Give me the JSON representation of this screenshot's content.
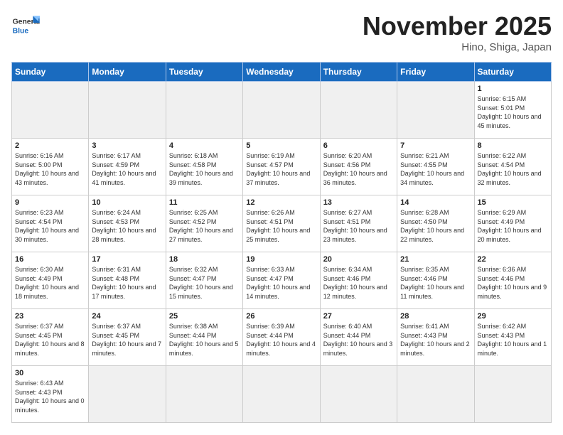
{
  "logo": {
    "line1": "General",
    "line2": "Blue"
  },
  "title": "November 2025",
  "subtitle": "Hino, Shiga, Japan",
  "weekdays": [
    "Sunday",
    "Monday",
    "Tuesday",
    "Wednesday",
    "Thursday",
    "Friday",
    "Saturday"
  ],
  "days": [
    {
      "date": "",
      "info": ""
    },
    {
      "date": "",
      "info": ""
    },
    {
      "date": "",
      "info": ""
    },
    {
      "date": "",
      "info": ""
    },
    {
      "date": "",
      "info": ""
    },
    {
      "date": "",
      "info": ""
    },
    {
      "date": "1",
      "info": "Sunrise: 6:15 AM\nSunset: 5:01 PM\nDaylight: 10 hours and 45 minutes."
    },
    {
      "date": "2",
      "info": "Sunrise: 6:16 AM\nSunset: 5:00 PM\nDaylight: 10 hours and 43 minutes."
    },
    {
      "date": "3",
      "info": "Sunrise: 6:17 AM\nSunset: 4:59 PM\nDaylight: 10 hours and 41 minutes."
    },
    {
      "date": "4",
      "info": "Sunrise: 6:18 AM\nSunset: 4:58 PM\nDaylight: 10 hours and 39 minutes."
    },
    {
      "date": "5",
      "info": "Sunrise: 6:19 AM\nSunset: 4:57 PM\nDaylight: 10 hours and 37 minutes."
    },
    {
      "date": "6",
      "info": "Sunrise: 6:20 AM\nSunset: 4:56 PM\nDaylight: 10 hours and 36 minutes."
    },
    {
      "date": "7",
      "info": "Sunrise: 6:21 AM\nSunset: 4:55 PM\nDaylight: 10 hours and 34 minutes."
    },
    {
      "date": "8",
      "info": "Sunrise: 6:22 AM\nSunset: 4:54 PM\nDaylight: 10 hours and 32 minutes."
    },
    {
      "date": "9",
      "info": "Sunrise: 6:23 AM\nSunset: 4:54 PM\nDaylight: 10 hours and 30 minutes."
    },
    {
      "date": "10",
      "info": "Sunrise: 6:24 AM\nSunset: 4:53 PM\nDaylight: 10 hours and 28 minutes."
    },
    {
      "date": "11",
      "info": "Sunrise: 6:25 AM\nSunset: 4:52 PM\nDaylight: 10 hours and 27 minutes."
    },
    {
      "date": "12",
      "info": "Sunrise: 6:26 AM\nSunset: 4:51 PM\nDaylight: 10 hours and 25 minutes."
    },
    {
      "date": "13",
      "info": "Sunrise: 6:27 AM\nSunset: 4:51 PM\nDaylight: 10 hours and 23 minutes."
    },
    {
      "date": "14",
      "info": "Sunrise: 6:28 AM\nSunset: 4:50 PM\nDaylight: 10 hours and 22 minutes."
    },
    {
      "date": "15",
      "info": "Sunrise: 6:29 AM\nSunset: 4:49 PM\nDaylight: 10 hours and 20 minutes."
    },
    {
      "date": "16",
      "info": "Sunrise: 6:30 AM\nSunset: 4:49 PM\nDaylight: 10 hours and 18 minutes."
    },
    {
      "date": "17",
      "info": "Sunrise: 6:31 AM\nSunset: 4:48 PM\nDaylight: 10 hours and 17 minutes."
    },
    {
      "date": "18",
      "info": "Sunrise: 6:32 AM\nSunset: 4:47 PM\nDaylight: 10 hours and 15 minutes."
    },
    {
      "date": "19",
      "info": "Sunrise: 6:33 AM\nSunset: 4:47 PM\nDaylight: 10 hours and 14 minutes."
    },
    {
      "date": "20",
      "info": "Sunrise: 6:34 AM\nSunset: 4:46 PM\nDaylight: 10 hours and 12 minutes."
    },
    {
      "date": "21",
      "info": "Sunrise: 6:35 AM\nSunset: 4:46 PM\nDaylight: 10 hours and 11 minutes."
    },
    {
      "date": "22",
      "info": "Sunrise: 6:36 AM\nSunset: 4:46 PM\nDaylight: 10 hours and 9 minutes."
    },
    {
      "date": "23",
      "info": "Sunrise: 6:37 AM\nSunset: 4:45 PM\nDaylight: 10 hours and 8 minutes."
    },
    {
      "date": "24",
      "info": "Sunrise: 6:37 AM\nSunset: 4:45 PM\nDaylight: 10 hours and 7 minutes."
    },
    {
      "date": "25",
      "info": "Sunrise: 6:38 AM\nSunset: 4:44 PM\nDaylight: 10 hours and 5 minutes."
    },
    {
      "date": "26",
      "info": "Sunrise: 6:39 AM\nSunset: 4:44 PM\nDaylight: 10 hours and 4 minutes."
    },
    {
      "date": "27",
      "info": "Sunrise: 6:40 AM\nSunset: 4:44 PM\nDaylight: 10 hours and 3 minutes."
    },
    {
      "date": "28",
      "info": "Sunrise: 6:41 AM\nSunset: 4:43 PM\nDaylight: 10 hours and 2 minutes."
    },
    {
      "date": "29",
      "info": "Sunrise: 6:42 AM\nSunset: 4:43 PM\nDaylight: 10 hours and 1 minute."
    },
    {
      "date": "30",
      "info": "Sunrise: 6:43 AM\nSunset: 4:43 PM\nDaylight: 10 hours and 0 minutes."
    },
    {
      "date": "",
      "info": ""
    },
    {
      "date": "",
      "info": ""
    },
    {
      "date": "",
      "info": ""
    },
    {
      "date": "",
      "info": ""
    },
    {
      "date": "",
      "info": ""
    },
    {
      "date": "",
      "info": ""
    }
  ]
}
